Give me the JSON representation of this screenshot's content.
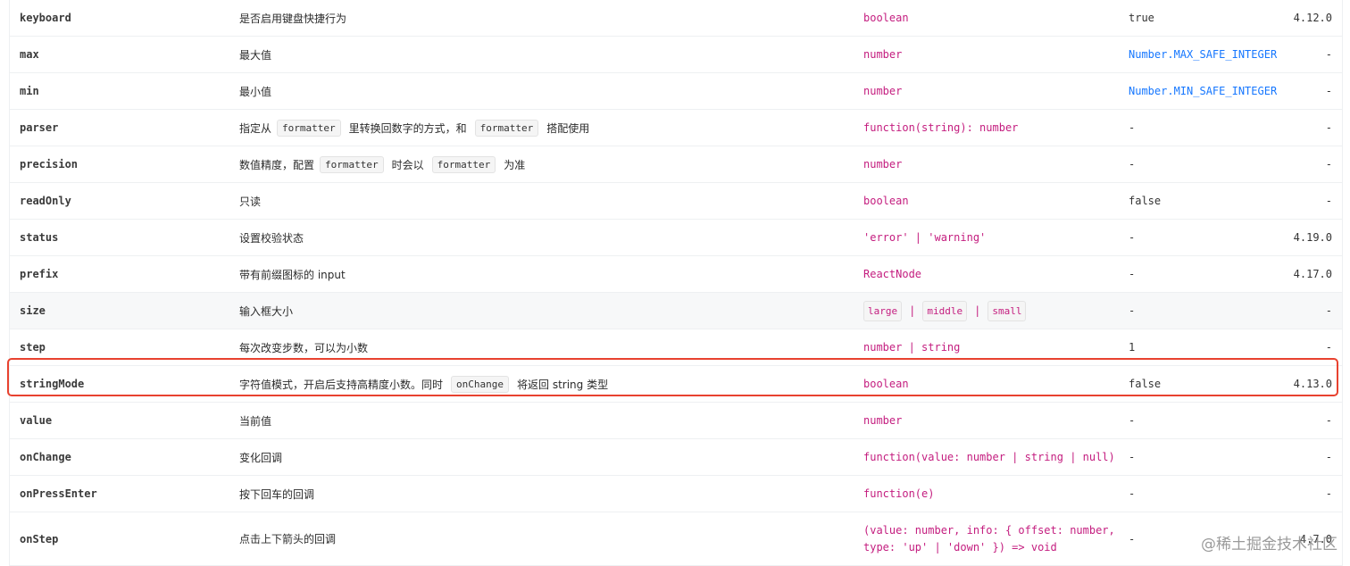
{
  "rows": [
    {
      "prop": "keyboard",
      "desc": "是否启用键盘快捷行为",
      "type": "boolean",
      "default": "true",
      "version": "4.12.0"
    },
    {
      "prop": "max",
      "desc": "最大值",
      "type": "number",
      "default": "Number.MAX_SAFE_INTEGER",
      "version": "-"
    },
    {
      "prop": "min",
      "desc": "最小值",
      "type": "number",
      "default": "Number.MIN_SAFE_INTEGER",
      "version": "-"
    },
    {
      "prop": "parser",
      "desc_parts": [
        "指定从",
        "formatter",
        "里转换回数字的方式，和",
        "formatter",
        "搭配使用"
      ],
      "type": "function(string): number",
      "default": "-",
      "version": "-"
    },
    {
      "prop": "precision",
      "desc_parts": [
        "数值精度，配置",
        "formatter",
        "时会以",
        "formatter",
        "为准"
      ],
      "type": "number",
      "default": "-",
      "version": "-"
    },
    {
      "prop": "readOnly",
      "desc": "只读",
      "type": "boolean",
      "default": "false",
      "version": "-"
    },
    {
      "prop": "status",
      "desc": "设置校验状态",
      "type": "'error' | 'warning'",
      "default": "-",
      "version": "4.19.0"
    },
    {
      "prop": "prefix",
      "desc": "带有前缀图标的 input",
      "type": "ReactNode",
      "default": "-",
      "version": "4.17.0"
    },
    {
      "prop": "size",
      "desc": "输入框大小",
      "type_tags": [
        "large",
        "middle",
        "small"
      ],
      "type_sep": "|",
      "default": "-",
      "version": "-"
    },
    {
      "prop": "step",
      "desc": "每次改变步数，可以为小数",
      "type": "number | string",
      "default": "1",
      "version": "-"
    },
    {
      "prop": "stringMode",
      "desc_parts": [
        "字符值模式，开启后支持高精度小数。同时",
        "onChange",
        "将返回 string 类型"
      ],
      "type": "boolean",
      "default": "false",
      "version": "4.13.0"
    },
    {
      "prop": "value",
      "desc": "当前值",
      "type": "number",
      "default": "-",
      "version": "-"
    },
    {
      "prop": "onChange",
      "desc": "变化回调",
      "type": "function(value: number | string | null)",
      "default": "-",
      "version": "-"
    },
    {
      "prop": "onPressEnter",
      "desc": "按下回车的回调",
      "type": "function(e)",
      "default": "-",
      "version": "-"
    },
    {
      "prop": "onStep",
      "desc": "点击上下箭头的回调",
      "type_lines": [
        "(value: number, info: { offset: number,",
        "type: 'up' | 'down' }) => void"
      ],
      "default": "-",
      "version": "4.7.0"
    }
  ],
  "watermark": "@稀土掘金技术社区",
  "colors": {
    "type": "#c41d7f",
    "link": "#1677ff",
    "highlight": "#e8422f",
    "border": "#eef0f2",
    "shaded_row": "#f7f8f9"
  }
}
